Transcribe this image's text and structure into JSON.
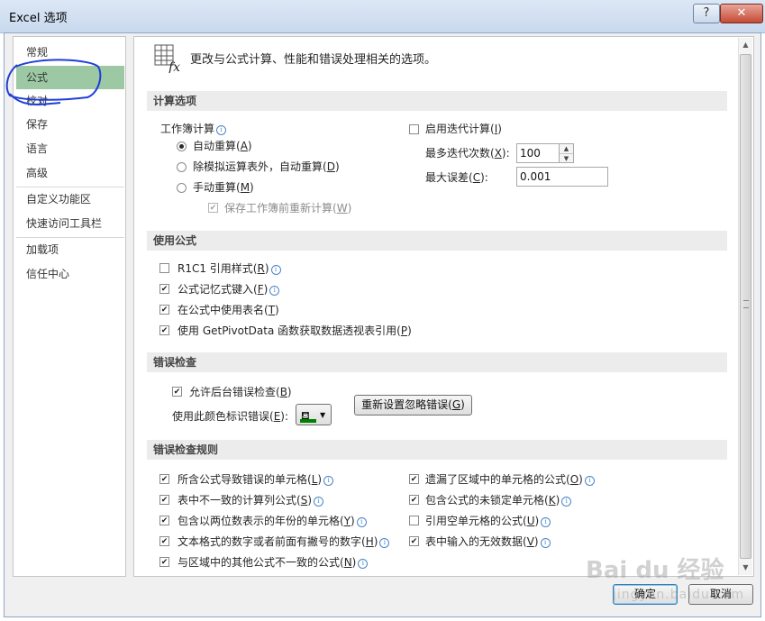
{
  "window": {
    "title": "Excel 选项",
    "help": "?",
    "close": "✕"
  },
  "sidebar": {
    "items": [
      {
        "label": "常规"
      },
      {
        "label": "公式"
      },
      {
        "label": "校对"
      },
      {
        "label": "保存"
      },
      {
        "label": "语言"
      },
      {
        "label": "高级"
      },
      {
        "label": "自定义功能区"
      },
      {
        "label": "快速访问工具栏"
      },
      {
        "label": "加载项"
      },
      {
        "label": "信任中心"
      }
    ],
    "selected": "公式"
  },
  "header": {
    "text": "更改与公式计算、性能和错误处理相关的选项。",
    "icon": "formula-fx-icon"
  },
  "calc": {
    "section": "计算选项",
    "workbook_label": "工作簿计算",
    "radio_auto": "自动重算(",
    "radio_auto_key": "A",
    "radio_except": "除模拟运算表外，自动重算(",
    "radio_except_key": "D",
    "radio_manual": "手动重算(",
    "radio_manual_key": "M",
    "recalc_before_save": "保存工作簿前重新计算(",
    "recalc_before_save_key": "W",
    "iterative": "启用迭代计算(",
    "iterative_key": "I",
    "max_iter_label": "最多迭代次数(",
    "max_iter_key": "X",
    "max_iter_value": "100",
    "max_change_label": "最大误差(",
    "max_change_key": "C",
    "max_change_value": "0.001",
    "close_paren": "):",
    "paren_close": ")"
  },
  "formulas": {
    "section": "使用公式",
    "items": [
      {
        "label": "R1C1 引用样式(",
        "key": "R",
        "checked": false,
        "info": true
      },
      {
        "label": "公式记忆式键入(",
        "key": "F",
        "checked": true,
        "info": true
      },
      {
        "label": "在公式中使用表名(",
        "key": "T",
        "checked": true,
        "info": false
      },
      {
        "label": "使用 GetPivotData 函数获取数据透视表引用(",
        "key": "P",
        "checked": true,
        "info": false
      }
    ]
  },
  "errors": {
    "section": "错误检查",
    "background": "允许后台错误检查(",
    "background_key": "B",
    "color_label": "使用此颜色标识错误(",
    "color_key": "E",
    "reset_button": "重新设置忽略错误(",
    "reset_key": "G",
    "indicator_color": "#008000"
  },
  "rules": {
    "section": "错误检查规则",
    "left": [
      {
        "label": "所含公式导致错误的单元格(",
        "key": "L",
        "checked": true
      },
      {
        "label": "表中不一致的计算列公式(",
        "key": "S",
        "checked": true
      },
      {
        "label": "包含以两位数表示的年份的单元格(",
        "key": "Y",
        "checked": true
      },
      {
        "label": "文本格式的数字或者前面有撇号的数字(",
        "key": "H",
        "checked": true
      },
      {
        "label": "与区域中的其他公式不一致的公式(",
        "key": "N",
        "checked": true
      }
    ],
    "right": [
      {
        "label": "遗漏了区域中的单元格的公式(",
        "key": "O",
        "checked": true
      },
      {
        "label": "包含公式的未锁定单元格(",
        "key": "K",
        "checked": true
      },
      {
        "label": "引用空单元格的公式(",
        "key": "U",
        "checked": false
      },
      {
        "label": "表中输入的无效数据(",
        "key": "V",
        "checked": true
      }
    ]
  },
  "footer": {
    "ok": "确定",
    "cancel": "取消"
  },
  "watermark": {
    "text": "Bai du 经验",
    "sub": "jingyan.baidu.com"
  },
  "colors": {
    "selected_nav": "#9cc9a3",
    "annotation": "#1f3fd8"
  }
}
